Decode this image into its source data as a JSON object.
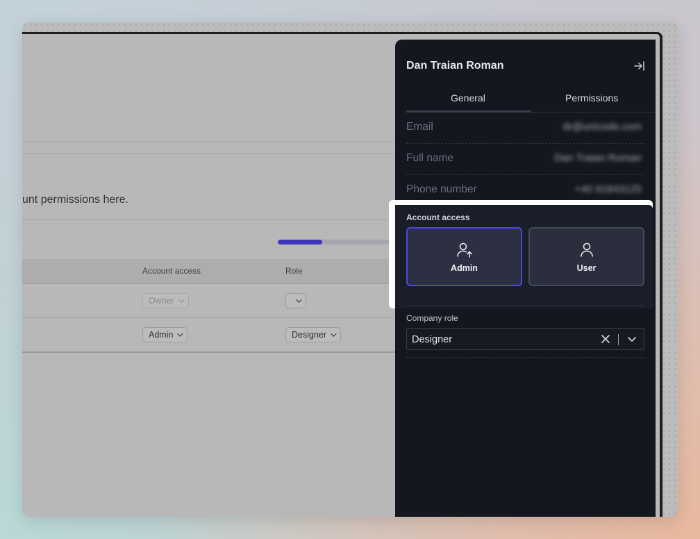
{
  "background_app": {
    "description_text": "unt permissions here.",
    "progress_fraction": 0.37,
    "table": {
      "headers": {
        "account_access": "Account access",
        "role": "Role"
      },
      "rows": [
        {
          "access": "Owner",
          "access_muted": true,
          "role": ""
        },
        {
          "access": "Admin",
          "access_muted": false,
          "role": "Designer"
        }
      ]
    }
  },
  "drawer": {
    "title": "Dan Traian Roman",
    "tabs": [
      {
        "label": "General",
        "active": true
      },
      {
        "label": "Permissions",
        "active": false
      }
    ],
    "fields": [
      {
        "label": "Email",
        "value": "dr@unicode.com"
      },
      {
        "label": "Full name",
        "value": "Dan Traian Roman"
      },
      {
        "label": "Phone number",
        "value": "+40 91843125"
      }
    ],
    "account_access": {
      "label": "Account access",
      "options": [
        {
          "label": "Admin",
          "icon": "user-up-icon",
          "selected": true
        },
        {
          "label": "User",
          "icon": "user-icon",
          "selected": false
        }
      ]
    },
    "company_role": {
      "label": "Company role",
      "value": "Designer"
    }
  },
  "colors": {
    "accent": "#4f46e5",
    "drawer_bg": "#14171f",
    "progress": "#3d35b9"
  }
}
